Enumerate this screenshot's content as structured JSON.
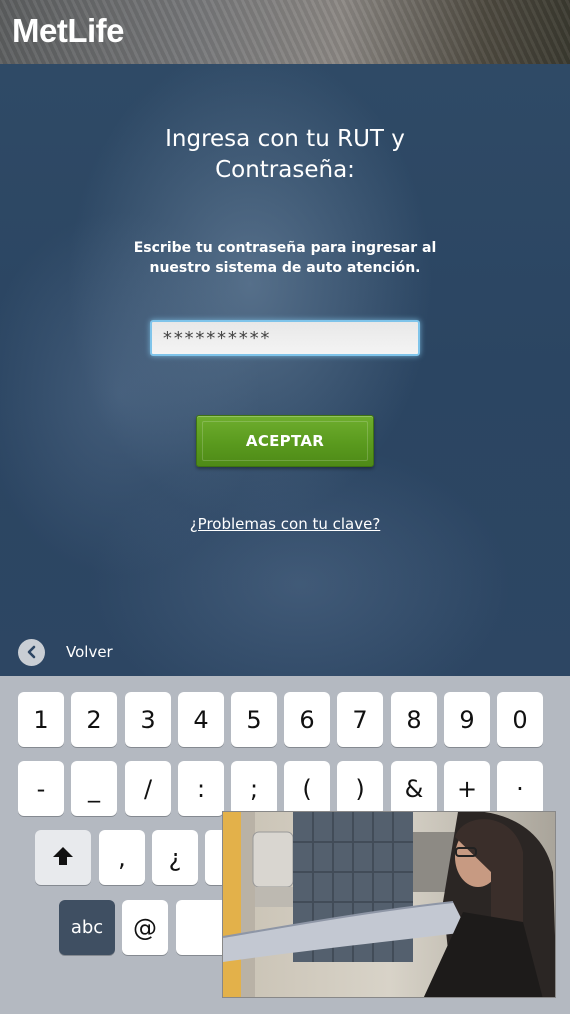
{
  "brand": {
    "logo_text": "MetLife"
  },
  "login": {
    "title_line1": "Ingresa con tu RUT y",
    "title_line2": "Contraseña:",
    "subtitle_line1": "Escribe tu contraseña para ingresar al",
    "subtitle_line2": "nuestro sistema de auto atención.",
    "password_value": "**********",
    "accept_label": "ACEPTAR",
    "problems_link": "¿Problemas con tu clave?",
    "back_label": "Volver"
  },
  "keyboard": {
    "row1": [
      "1",
      "2",
      "3",
      "4",
      "5",
      "6",
      "7",
      "8",
      "9",
      "0"
    ],
    "row2": [
      "-",
      "_",
      "/",
      ":",
      ";",
      "(",
      ")",
      "&",
      "+",
      "·"
    ],
    "row3": [
      ",",
      "¿"
    ],
    "row4_abc": "abc",
    "row4_at": "@"
  },
  "colors": {
    "panel_blue": "#2d4663",
    "accept_green": "#5a9a1e",
    "input_focus": "#7fc4ea"
  }
}
